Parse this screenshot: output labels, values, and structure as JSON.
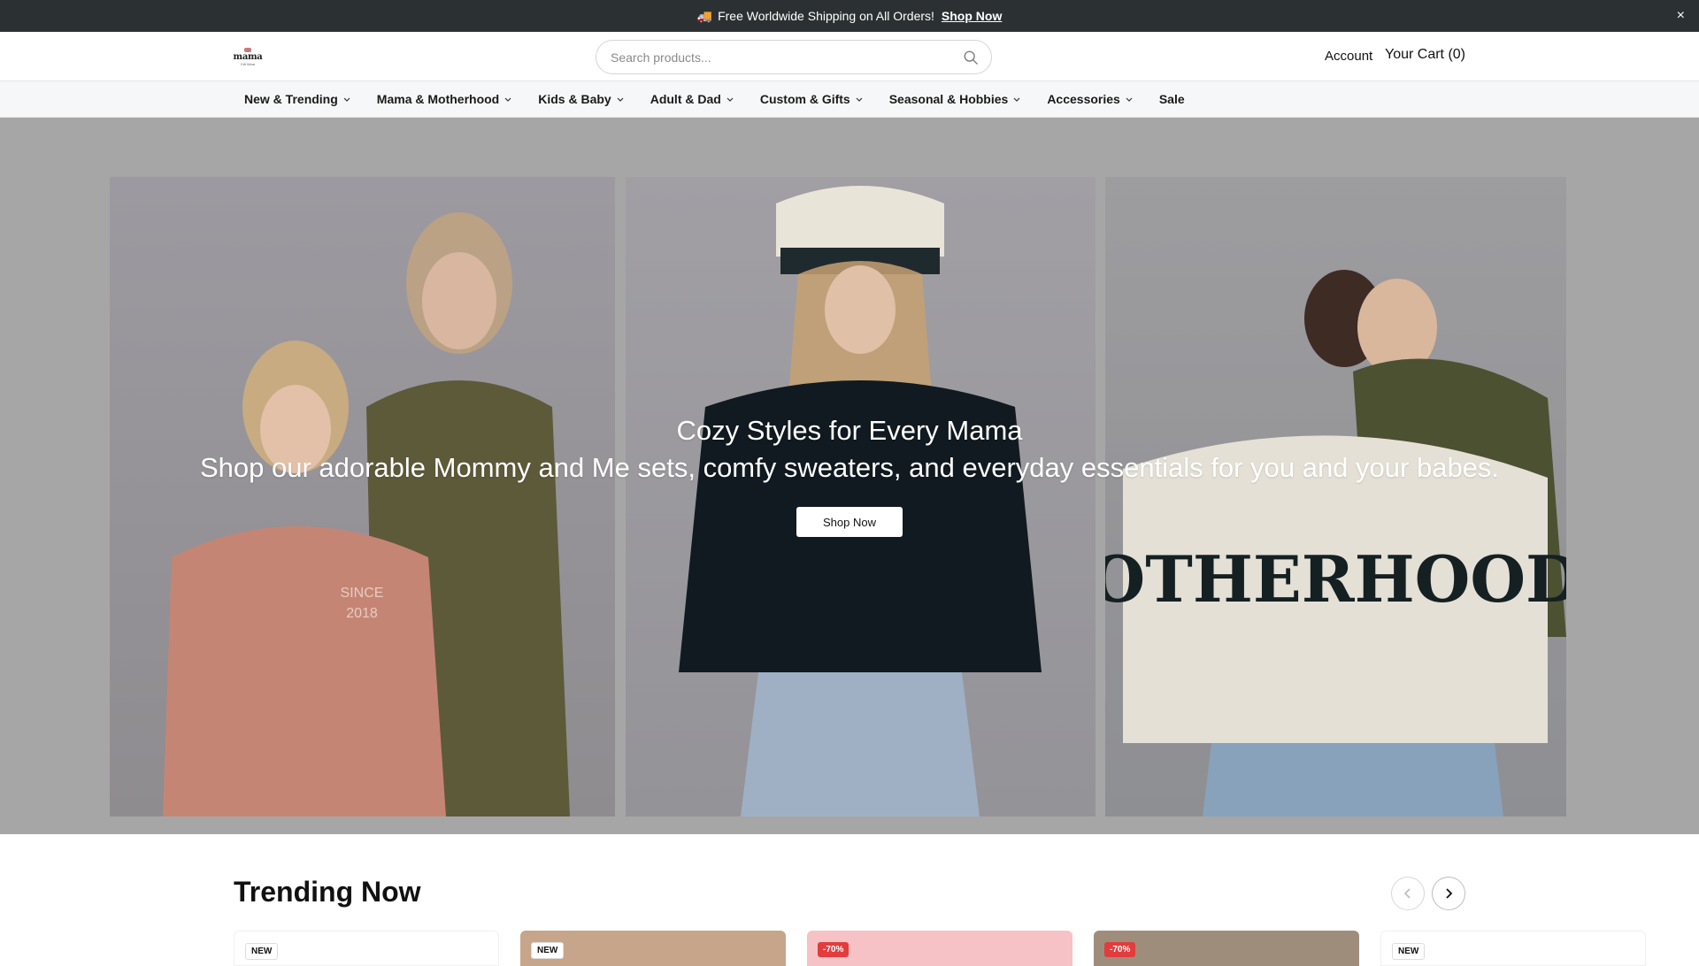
{
  "announcement": {
    "emoji": "🚚",
    "text": "Free Worldwide Shipping on All Orders!",
    "cta": "Shop Now",
    "close": "×"
  },
  "header": {
    "logo_word": "mama",
    "logo_sub": "Gift Wear",
    "search_placeholder": "Search products...",
    "account": "Account",
    "cart": "Your Cart (0)"
  },
  "nav": {
    "items": [
      {
        "label": "New & Trending",
        "dropdown": true
      },
      {
        "label": "Mama & Motherhood",
        "dropdown": true
      },
      {
        "label": "Kids & Baby",
        "dropdown": true
      },
      {
        "label": "Adult & Dad",
        "dropdown": true
      },
      {
        "label": "Custom & Gifts",
        "dropdown": true
      },
      {
        "label": "Seasonal & Hobbies",
        "dropdown": true
      },
      {
        "label": "Accessories",
        "dropdown": true
      },
      {
        "label": "Sale",
        "dropdown": false
      }
    ]
  },
  "hero": {
    "title": "Cozy Styles for Every Mama",
    "subtitle": "Shop our adorable Mommy and Me sets, comfy sweaters, and everyday essentials for you and your babes.",
    "button": "Shop Now"
  },
  "trending": {
    "title": "Trending Now",
    "cards": [
      {
        "badge": "NEW",
        "badge_type": "new",
        "color": "#ffffff"
      },
      {
        "badge": "NEW",
        "badge_type": "new",
        "color": "#c7a58a"
      },
      {
        "badge": "-70%",
        "badge_type": "sale",
        "color": "#f6c2c6"
      },
      {
        "badge": "-70%",
        "badge_type": "sale",
        "color": "#9f8d7c"
      },
      {
        "badge": "NEW",
        "badge_type": "new",
        "color": "#ffffff"
      }
    ]
  },
  "colors": {
    "announcement_bg": "#2b3133",
    "hero_bg": "#a6a6a6",
    "sale_badge": "#e23c3c"
  }
}
